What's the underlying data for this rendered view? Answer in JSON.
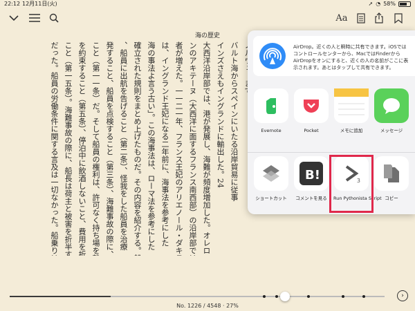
{
  "status": {
    "time": "22:12",
    "date": "12月11日(火)",
    "battery": "58%"
  },
  "toolbar": {
    "back_icon": "chevron-down-icon",
    "toc_icon": "list-icon",
    "search_icon": "search-icon",
    "font_label": "Aa",
    "notes_icon": "document-icon",
    "share_icon": "share-icon",
    "bookmark_icon": "bookmark-icon"
  },
  "book": {
    "title": "海の歴史",
    "columns": [
      "ノルウェーまで、",
      "バルト海からスペインにいたる沿岸貿易に従事",
      "インズさえもイングランドに輸出した。24",
      "大西洋沿岸部では、港が発展し、海難が頻度増加した。オレロン",
      "ンのアキテーヌ（大西洋に面するフランス南西部）の沿岸部では、漂流物を",
      "者が増えた。一一二一年、フランス王妃のアリエノール・ダキテ",
      "は、イングランド王妃になる二年前に、海事法を参考にした",
      "海の事法よ言う古い」。この海事法は、ローマ法を参考にした（先ほど述べた",
      "確立された規則をまとめ上げたものだ。その内容を紹介する。船長の義",
      "、船員に出航を告げること（第二条）、怪我をした船員を治療",
      "発すること、船員を点検すること（第三条）、海難事故の際に、積荷を海",
      "こと（第一一条）だ。そして船員の権利は、許可なく持ち場を離れ",
      "を約束すること（第五条）、停泊中に飲酒しないこと、費用を折半すること",
      "こと（第一五条）。海難事故の際に、船長は荷主と被害を折半すること",
      "だった。船員の労働条件に関する言及は一切なかった。船乗りは奴隷に"
    ]
  },
  "share": {
    "airdrop_text": "AirDrop。近くの人と瞬時に共有できます。iOSではコントロールセンターから、MacではFinderからAirDropをオンにすると、近くの人の名前がここに表示されます。あとはタップして共有できます。",
    "apps_row1": [
      {
        "label": "Evernote",
        "icon": "evernote-icon",
        "color": "#ffffff"
      },
      {
        "label": "Pocket",
        "icon": "pocket-icon",
        "color": "#ffffff"
      },
      {
        "label": "メモに追加",
        "icon": "notes-icon",
        "color": "#ffffff"
      },
      {
        "label": "メッセージ",
        "icon": "messages-icon",
        "color": "#5ad15a"
      }
    ],
    "apps_row2": [
      {
        "label": "ショートカット",
        "icon": "shortcuts-icon",
        "color": "#ffffff"
      },
      {
        "label": "コメントを見る",
        "icon": "hatena-icon",
        "color": "#ffffff"
      },
      {
        "label": "Run Pythonista Script",
        "icon": "pythonista-icon",
        "color": "#ffffff",
        "badge": "3"
      },
      {
        "label": "コピー",
        "icon": "copy-icon",
        "color": "#ffffff"
      }
    ]
  },
  "footer": {
    "page_info": "No. 1226 / 4548 · 27%",
    "progress": 0.27,
    "next_icon": "next-chapter-icon"
  }
}
